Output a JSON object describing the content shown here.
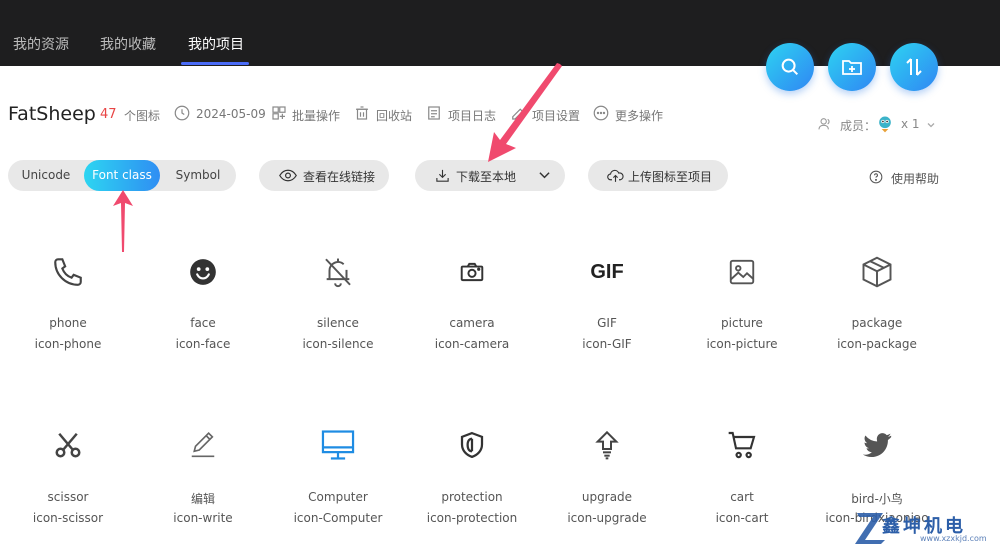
{
  "nav": {
    "tabs": [
      {
        "label": "我的资源"
      },
      {
        "label": "我的收藏"
      },
      {
        "label": "我的项目"
      }
    ],
    "accent": "#4a6cf7"
  },
  "fab": {
    "search_icon": "search-icon",
    "add_folder_icon": "folder-add-icon",
    "sort_icon": "sort-icon"
  },
  "project": {
    "title": "FatSheep",
    "icon_count": "47",
    "icon_count_unit": "个图标",
    "date": "2024-05-09",
    "actions": [
      {
        "label": "批量操作",
        "icon": "batch-icon"
      },
      {
        "label": "回收站",
        "icon": "trash-icon"
      },
      {
        "label": "项目日志",
        "icon": "log-icon"
      },
      {
        "label": "项目设置",
        "icon": "settings-icon"
      },
      {
        "label": "更多操作",
        "icon": "more-icon"
      }
    ],
    "members_label": "成员：",
    "members_count": "x 1"
  },
  "toolbar": {
    "modes": [
      {
        "label": "Unicode"
      },
      {
        "label": "Font class"
      },
      {
        "label": "Symbol"
      }
    ],
    "view_online_link": "查看在线链接",
    "download_local": "下载至本地",
    "upload_icons": "上传图标至项目",
    "help": "使用帮助"
  },
  "icons": [
    {
      "name": "phone",
      "class": "icon-phone"
    },
    {
      "name": "face",
      "class": "icon-face"
    },
    {
      "name": "silence",
      "class": "icon-silence"
    },
    {
      "name": "camera",
      "class": "icon-camera"
    },
    {
      "name": "GIF",
      "class": "icon-GIF"
    },
    {
      "name": "picture",
      "class": "icon-picture"
    },
    {
      "name": "package",
      "class": "icon-package"
    },
    {
      "name": "scissor",
      "class": "icon-scissor"
    },
    {
      "name": "编辑",
      "class": "icon-write"
    },
    {
      "name": "Computer",
      "class": "icon-Computer"
    },
    {
      "name": "protection",
      "class": "icon-protection"
    },
    {
      "name": "upgrade",
      "class": "icon-upgrade"
    },
    {
      "name": "cart",
      "class": "icon-cart"
    },
    {
      "name": "bird-小鸟",
      "class": "icon-birdxiaoniao"
    }
  ],
  "gif_glyph_text": "GIF",
  "watermark": {
    "text": "鑫坤机电",
    "url": "www.xzxkjd.com"
  },
  "colors": {
    "accent_gradient_start": "#2dd5f1",
    "accent_gradient_end": "#2f8ef3",
    "count": "#e84545",
    "arrow": "#f04a6e"
  }
}
